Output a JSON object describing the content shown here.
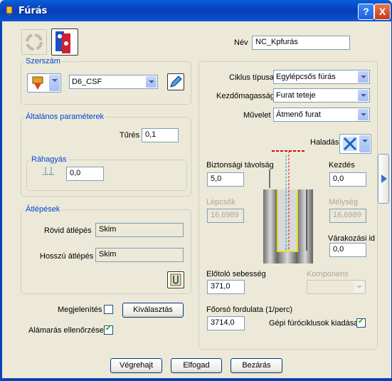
{
  "window": {
    "title": "Fúrás",
    "help_label": "?",
    "close_label": "X"
  },
  "left": {
    "nev_label": "Név",
    "nev_value": "NC_Kpfurás",
    "szerszam": {
      "label": "Szerszám",
      "tool_value": "D6_CSF"
    },
    "altalanos": {
      "label": "Általános paraméterek",
      "tures_label": "Tűrés",
      "tures_value": "0,1",
      "rahagyas_label": "Ráhagyás",
      "rahagyas_value": "0,0"
    },
    "atlepesek": {
      "label": "Átlépések",
      "rovid_label": "Rövid átlépés",
      "rovid_value": "Skim",
      "hosszu_label": "Hosszú átlépés",
      "hosszu_value": "Skim"
    },
    "megjelenites_label": "Megjelenítés",
    "megjelenites_checked": false,
    "kivalasztas_label": "Kiválasztás",
    "alamaras_label": "Alámarás ellenőrzése",
    "alamaras_checked": true
  },
  "right": {
    "ciklus_label": "Ciklus típusa",
    "ciklus_value": "Egylépcsős fúrás",
    "kezdo_label": "Kezdőmagasság",
    "kezdo_value": "Furat teteje",
    "muvelet_label": "Művelet",
    "muvelet_value": "Átmenő furat",
    "haladas_label": "Haladás",
    "bizt_label": "Biztonsági távolság",
    "bizt_value": "5,0",
    "kezdes_label": "Kezdés",
    "kezdes_value": "0,0",
    "lepcsok_label": "Lépcsők",
    "lepcsok_value": "16,6989",
    "melyseg_label": "Mélység",
    "melyseg_value": "16,6989",
    "varakozasi_label": "Várakozási idő",
    "varakozasi_value": "0,0",
    "eloto_label": "Előtoló sebesség",
    "eloto_value": "371,0",
    "komponens_label": "Komponens",
    "foorso_label": "Főorsó fordulata (1/perc)",
    "foorso_value": "3714,0",
    "gepi_label": "Gépi fúróciklusok kiadása",
    "gepi_checked": true
  },
  "buttons": {
    "vegrehajt": "Végrehajt",
    "elfogad": "Elfogad",
    "bezaras": "Bezárás"
  }
}
